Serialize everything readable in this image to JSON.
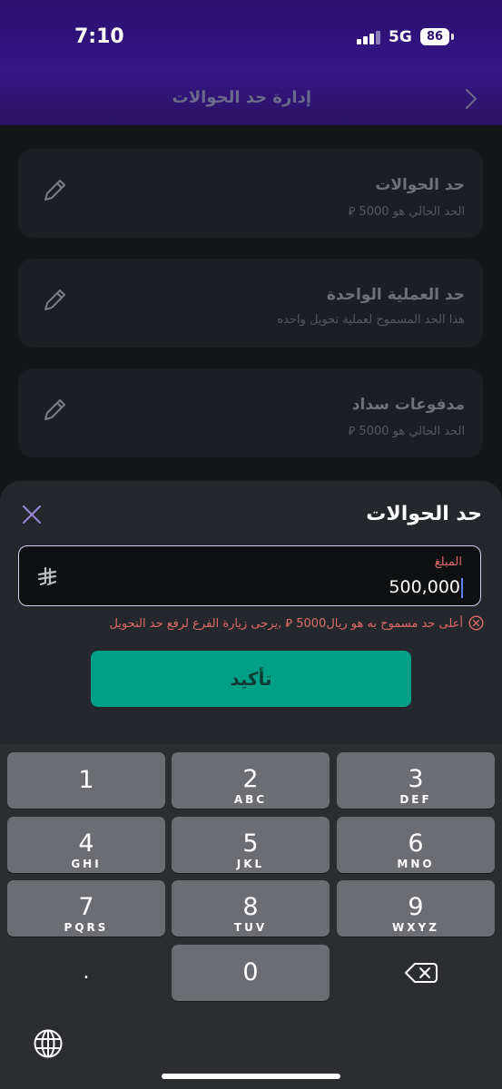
{
  "status": {
    "time": "7:10",
    "network": "5G",
    "battery": "86"
  },
  "header": {
    "title": "إدارة حد الحوالات"
  },
  "cards": [
    {
      "title": "حد الحوالات",
      "subtitle": "الحد الحالي هو 5000 ⃁"
    },
    {
      "title": "حد العملية الواحدة",
      "subtitle": "هذا الحد المسموح لعملية تحويل واحده"
    },
    {
      "title": "مدفوعات سداد",
      "subtitle": "الحد الحالي هو 5000 ⃁"
    }
  ],
  "sheet": {
    "title": "حد الحوالات",
    "amount_label": "المبلغ",
    "amount_value": "500,000",
    "error": "أعلى حد مسموح به هو  ريال5000 ⃁ ,يرجى زيارة الفرع لرفع حد التحويل",
    "confirm_label": "تأكيد"
  },
  "keyboard": {
    "keys": [
      {
        "num": "1",
        "letters": ""
      },
      {
        "num": "2",
        "letters": "ABC"
      },
      {
        "num": "3",
        "letters": "DEF"
      },
      {
        "num": "4",
        "letters": "GHI"
      },
      {
        "num": "5",
        "letters": "JKL"
      },
      {
        "num": "6",
        "letters": "MNO"
      },
      {
        "num": "7",
        "letters": "PQRS"
      },
      {
        "num": "8",
        "letters": "TUV"
      },
      {
        "num": "9",
        "letters": "WXYZ"
      },
      {
        "num": "0",
        "letters": ""
      }
    ],
    "dot": "."
  },
  "colors": {
    "accent": "#00a088",
    "error": "#e06a6a",
    "header": "#2b0f6f"
  }
}
